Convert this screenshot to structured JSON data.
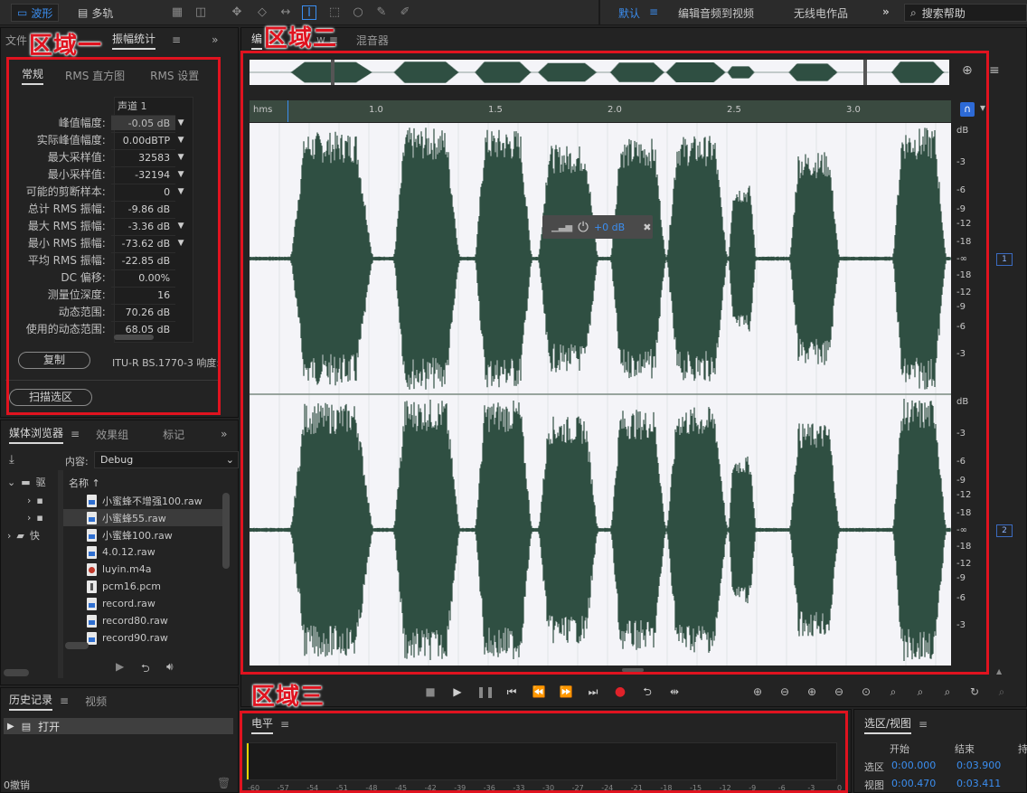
{
  "topbar": {
    "waveform_label": "波形",
    "multitrack_label": "多轨",
    "workspaces": [
      "默认",
      "编辑音频到视频",
      "无线电作品"
    ],
    "search_placeholder": "搜索帮助"
  },
  "annotations": {
    "region1": "区域一",
    "region2": "区域二",
    "region3": "区域三"
  },
  "left_panel": {
    "tabs": [
      "文件",
      "振幅统计"
    ],
    "subtabs": [
      "常规",
      "RMS 直方图",
      "RMS 设置"
    ],
    "channel_header": "声道 1",
    "stats": [
      {
        "label": "峰值幅度:",
        "value": "-0.05 dB"
      },
      {
        "label": "实际峰值幅度:",
        "value": "0.00dBTP"
      },
      {
        "label": "最大采样值:",
        "value": "32583"
      },
      {
        "label": "最小采样值:",
        "value": "-32194"
      },
      {
        "label": "可能的剪断样本:",
        "value": "0"
      },
      {
        "label": "总计 RMS 振幅:",
        "value": "-9.86 dB"
      },
      {
        "label": "最大 RMS 振幅:",
        "value": "-3.36 dB"
      },
      {
        "label": "最小 RMS 振幅:",
        "value": "-73.62 dB"
      },
      {
        "label": "平均 RMS 振幅:",
        "value": "-22.85 dB"
      },
      {
        "label": "DC 偏移:",
        "value": "0.00%"
      },
      {
        "label": "测量位深度:",
        "value": "16"
      },
      {
        "label": "动态范围:",
        "value": "70.26 dB"
      },
      {
        "label": "使用的动态范围:",
        "value": "68.05 dB"
      }
    ],
    "copy_button": "复制",
    "loudness_label": "ITU-R BS.1770-3 响度:",
    "scan_button": "扫描选区"
  },
  "media_browser": {
    "tabs": [
      "媒体浏览器",
      "效果组",
      "标记"
    ],
    "content_label": "内容:",
    "content_value": "Debug",
    "name_header": "名称",
    "tree": [
      "驱",
      "快"
    ],
    "files": [
      "小蜜蜂不增强100.raw",
      "小蜜蜂55.raw",
      "小蜜蜂100.raw",
      "4.0.12.raw",
      "luyin.m4a",
      "pcm16.pcm",
      "record.raw",
      "record80.raw",
      "record90.raw"
    ]
  },
  "history": {
    "tabs": [
      "历史记录",
      "视频"
    ],
    "open_label": "打开",
    "undo_label": "0撤销"
  },
  "editor": {
    "tabs": [
      "编",
      "w",
      "混音器"
    ],
    "ruler_unit": "hms",
    "ruler_ticks": [
      "1.0",
      "1.5",
      "2.0",
      "2.5",
      "3.0"
    ],
    "hud_gain": "+0 dB",
    "db_unit": "dB",
    "db_scale_top": [
      "-3",
      "-6",
      "-9",
      "-12",
      "-18",
      "-∞",
      "-18",
      "-12",
      "-9",
      "-6",
      "-3"
    ],
    "channels": [
      "1",
      "2"
    ]
  },
  "level_meter": {
    "tab": "电平",
    "scale": [
      "-60",
      "-57",
      "-54",
      "-51",
      "-48",
      "-45",
      "-42",
      "-39",
      "-36",
      "-33",
      "-30",
      "-27",
      "-24",
      "-21",
      "-18",
      "-15",
      "-12",
      "-9",
      "-6",
      "-3",
      "0"
    ]
  },
  "selection_view": {
    "tab": "选区/视图",
    "headers": [
      "开始",
      "结束",
      "持"
    ],
    "rows": [
      {
        "label": "选区",
        "start": "0:00.000",
        "end": "0:03.900"
      },
      {
        "label": "视图",
        "start": "0:00.470",
        "end": "0:03.411"
      }
    ]
  },
  "colors": {
    "accent": "#3b8ef0",
    "waveform": "#2f4f42",
    "waveform_bg": "#f4f4f8",
    "annotation": "#e0131f"
  }
}
